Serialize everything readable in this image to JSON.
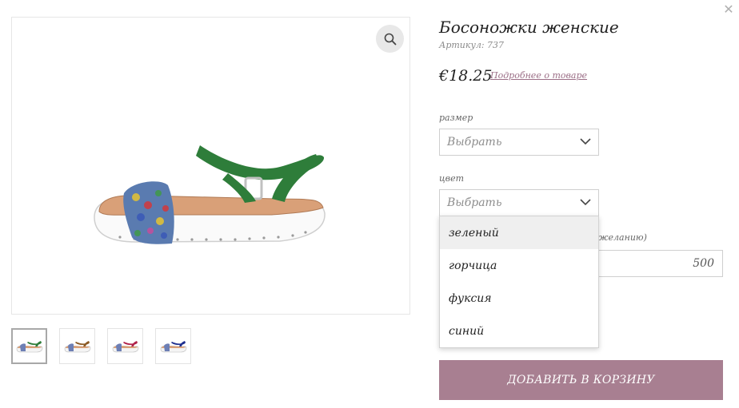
{
  "modal": {
    "close_icon": "close-icon"
  },
  "product": {
    "title": "Босоножки женские",
    "sku_label": "Артикул:",
    "sku_value": "737",
    "price": "€18.25",
    "details_link": "Подробнее о товаре"
  },
  "gallery": {
    "zoom_icon": "search-icon",
    "thumbnails": [
      {
        "color_name": "green",
        "strap": "#2e7d3a"
      },
      {
        "color_name": "mustard",
        "strap": "#8b5a24"
      },
      {
        "color_name": "fuchsia",
        "strap": "#b0224a"
      },
      {
        "color_name": "blue",
        "strap": "#1f2f8f"
      }
    ]
  },
  "options": {
    "size": {
      "label": "размер",
      "placeholder": "Выбрать"
    },
    "color": {
      "label": "цвет",
      "placeholder": "Выбрать",
      "items": [
        "зеленый",
        "горчица",
        "фуксия",
        "синий"
      ],
      "highlighted_index": 0
    },
    "amount": {
      "partial_label": "желанию)",
      "value": "500"
    }
  },
  "cart": {
    "add_button": "ДОБАВИТЬ В КОРЗИНУ"
  },
  "colors": {
    "accent": "#a87f91",
    "link": "#9b6e86",
    "strap_green": "#2e7d3a",
    "sole": "#ffffff",
    "footbed": "#d9a078"
  }
}
